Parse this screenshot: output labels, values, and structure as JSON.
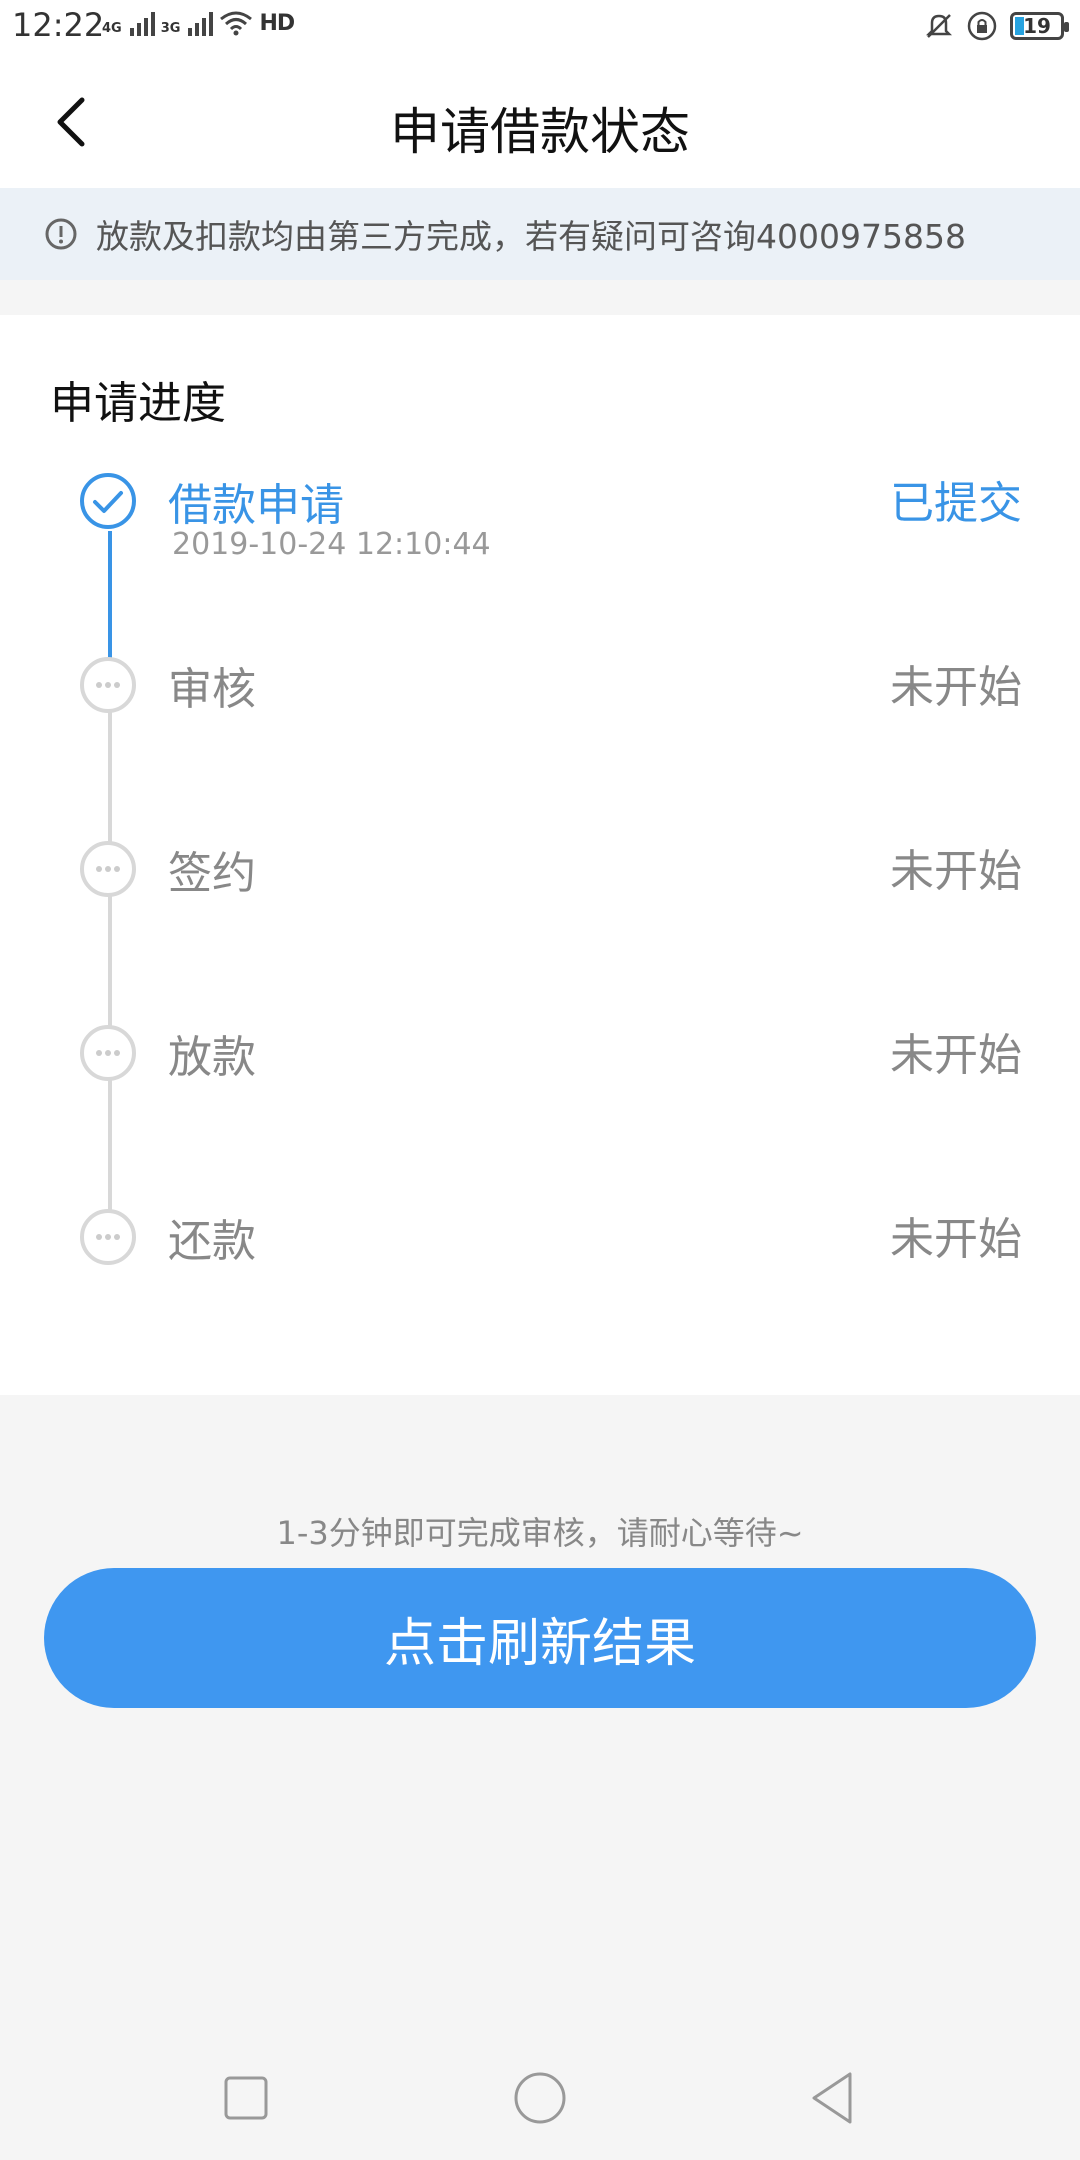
{
  "status_bar": {
    "time": "12:22",
    "network_1": "4G",
    "network_2": "3G",
    "hd_label": "HD",
    "battery_level": "19",
    "icons": [
      "mute-icon",
      "lock-rotation-icon",
      "battery-icon",
      "wifi-icon"
    ]
  },
  "header": {
    "title": "申请借款状态",
    "back_icon": "back-arrow-icon"
  },
  "notice": {
    "icon": "info-icon",
    "text": "放款及扣款均由第三方完成，若有疑问可咨询4000975858"
  },
  "progress": {
    "title": "申请进度",
    "steps": [
      {
        "label": "借款申请",
        "status": "已提交",
        "time": "2019-10-24 12:10:44",
        "state": "done"
      },
      {
        "label": "审核",
        "status": "未开始",
        "state": "pending"
      },
      {
        "label": "签约",
        "status": "未开始",
        "state": "pending"
      },
      {
        "label": "放款",
        "status": "未开始",
        "state": "pending"
      },
      {
        "label": "还款",
        "status": "未开始",
        "state": "pending"
      }
    ]
  },
  "footer": {
    "hint": "1-3分钟即可完成审核，请耐心等待~",
    "refresh_button": "点击刷新结果"
  },
  "colors": {
    "accent": "#3994e6",
    "button": "#3f97f0",
    "pending": "#d8d8d8"
  }
}
